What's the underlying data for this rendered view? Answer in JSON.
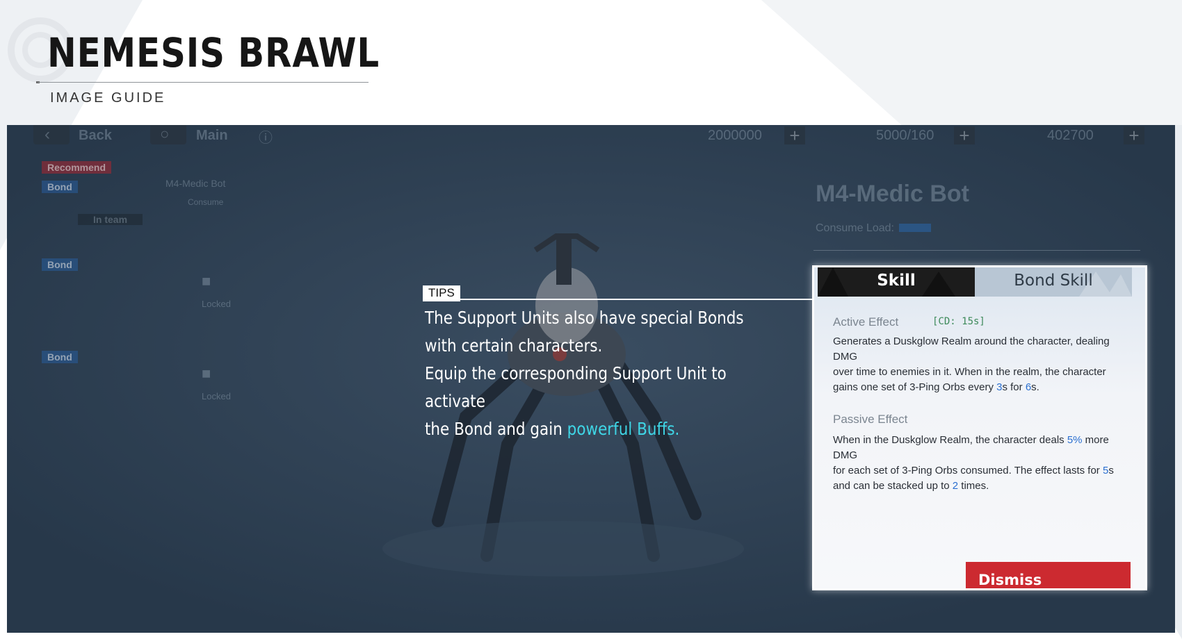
{
  "header": {
    "title": "NEMESIS BRAWL",
    "subtitle": "IMAGE GUIDE"
  },
  "game": {
    "topbar": {
      "back_label": "Back",
      "main_label": "Main",
      "currency_1": "2000000",
      "currency_2": "5000/160",
      "currency_3": "402700"
    },
    "unit_list": [
      {
        "tags": [
          "Recommend",
          "Bond"
        ],
        "status": "In team",
        "name": "M4-Medic Bot",
        "sub": "Consume"
      },
      {
        "tags": [
          "Bond"
        ],
        "status": "Locked"
      },
      {
        "tags": [
          "Bond"
        ],
        "status": "Locked"
      }
    ],
    "detail": {
      "name": "M4-Medic Bot",
      "consume_label": "Consume Load:"
    }
  },
  "tips": {
    "badge": "TIPS",
    "line1": "The Support Units also have special Bonds",
    "line2": "with certain characters.",
    "line3": "Equip the corresponding Support Unit to activate",
    "line4_a": "the Bond and gain ",
    "line4_highlight": "powerful Buffs.",
    "highlight_color": "#3fd6e6"
  },
  "skill_panel": {
    "tab_skill": "Skill",
    "tab_bond_skill": "Bond Skill",
    "active_title": "Active Effect",
    "active_cd": "[CD: 15s]",
    "active_l1": "Generates a Duskglow Realm around the character, dealing DMG",
    "active_l2": "over time to enemies in it. When in the realm, the character",
    "active_l3_a": "gains one set of 3-Ping Orbs every ",
    "active_l3_n1": "3",
    "active_l3_b": "s for ",
    "active_l3_n2": "6",
    "active_l3_c": "s.",
    "passive_title": "Passive Effect",
    "passive_l1_a": "When in the Duskglow Realm, the character deals ",
    "passive_l1_n": "5%",
    "passive_l1_b": " more DMG",
    "passive_l2_a": "for each set of 3-Ping Orbs consumed. The effect lasts for ",
    "passive_l2_n": "5",
    "passive_l2_b": "s",
    "passive_l3_a": "and can be stacked up to ",
    "passive_l3_n": "2",
    "passive_l3_b": " times.",
    "dismiss_label": "Dismiss",
    "number_color": "#2a6fd0",
    "dismiss_color": "#cc2a30"
  }
}
